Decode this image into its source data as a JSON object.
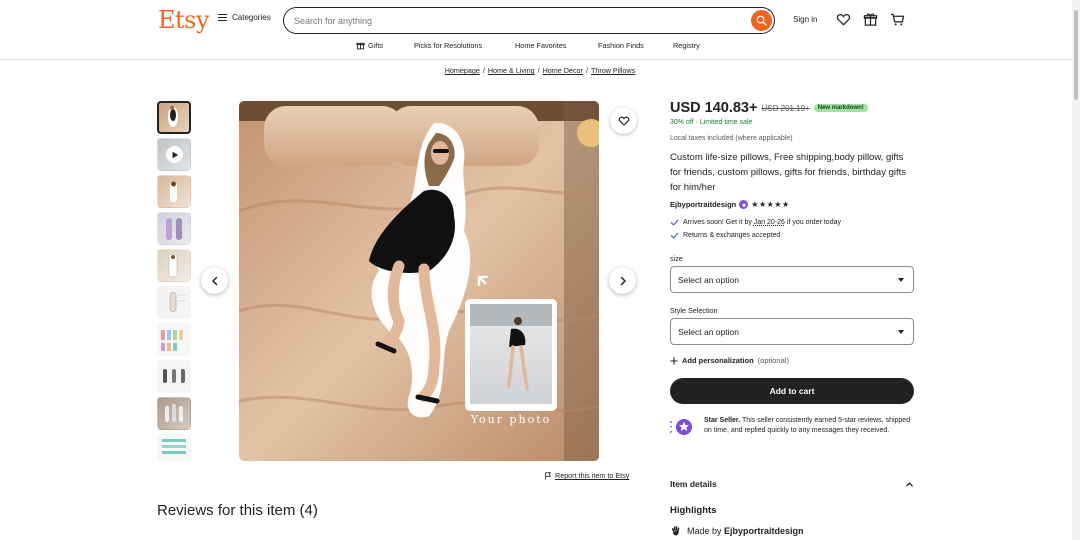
{
  "header": {
    "logo": "Etsy",
    "categories_label": "Categories",
    "search_placeholder": "Search for anything",
    "sign_in": "Sign in"
  },
  "subnav": [
    "Gifts",
    "Picks for Resolutions",
    "Home Favorites",
    "Fashion Finds",
    "Registry"
  ],
  "breadcrumb": [
    "Homepage",
    "Home & Living",
    "Home Decor",
    "Throw Pillows"
  ],
  "product": {
    "price": "USD 140.83+",
    "original_price": "USD 201.19+",
    "markdown_badge": "New markdown!",
    "discount": "30% off · Limited time sale",
    "taxes": "Local taxes included (where applicable)",
    "title": "Custom life-size pillows, Free shipping,body pillow, gifts for friends, custom pillows, gifts for friends, birthday gifts for him/her",
    "shop_name": "Ejbyportraitdesign",
    "stars": "★★★★★",
    "rating": 5,
    "arrival_prefix": "Arrives soon! Get it by ",
    "arrival_dates": "Jan 20-26",
    "arrival_suffix": " if you order today",
    "returns": "Returns & exchanges accepted",
    "size_label": "size",
    "size_value": "Select an option",
    "style_label": "Style Selection",
    "style_value": "Select an option",
    "personalization_label": "Add personalization",
    "personalization_optional": "(optional)",
    "add_to_cart": "Add to cart",
    "star_seller_title": "Star Seller.",
    "star_seller_text": " This seller consistently earned 5-star reviews, shipped on time, and replied quickly to any messages they received.",
    "item_details": "Item details",
    "highlights": "Highlights",
    "made_by_prefix": "Made by ",
    "made_by_shop": "Ejbyportraitdesign"
  },
  "image": {
    "overlay_text": "Your photo"
  },
  "report_link": "Report this item to Etsy",
  "reviews_title": "Reviews for this item (4)",
  "colors": {
    "brand": "#f1641e",
    "primary_button": "#222222",
    "discount_green": "#1c7a3b",
    "markdown_badge": "#9ee39e",
    "star_seller_purple": "#7e4bd8"
  }
}
